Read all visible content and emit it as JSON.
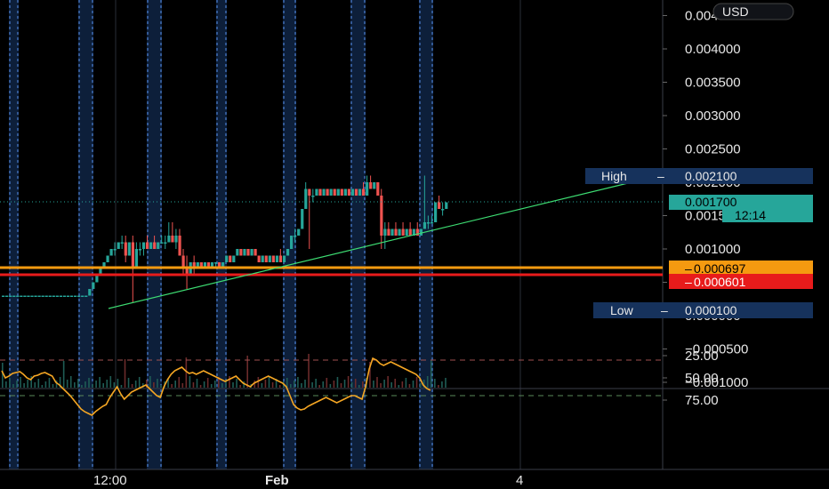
{
  "header": {
    "currency": "USD"
  },
  "colors": {
    "background": "#000000",
    "up": "#26a69a",
    "down": "#ef5350",
    "session_band": "#0d1f3a",
    "session_line": "#4a7fd0",
    "rsi_line": "#f5a623",
    "trendline": "#3ddc72",
    "support_orange": "#f59a10",
    "support_red": "#e81b1b",
    "high_low_tag": "#16325c",
    "current_price_tag": "#26a69a"
  },
  "chart_data": [
    {
      "type": "candlestick",
      "name": "price",
      "y_axis": {
        "ticks": [
          0.0045,
          0.004,
          0.0035,
          0.003,
          0.0025,
          0.002,
          0.0015,
          0.001,
          0.0005,
          0.0,
          -0.0005,
          -0.001
        ],
        "tick_labels": [
          "0.004500",
          "0.004000",
          "0.003500",
          "0.003000",
          "0.002500",
          "0.002000",
          "0.001500",
          "0.001000",
          "0.000500",
          "0.000000",
          "−0.000500",
          "−0.001000"
        ]
      },
      "x_axis": {
        "tick_labels": [
          "12:00",
          "Feb",
          "4"
        ],
        "bold": [
          "Feb"
        ]
      },
      "high": {
        "label": "High",
        "value": "0.002100"
      },
      "low": {
        "label": "Low",
        "value": "0.000100"
      },
      "current_price": {
        "value": "0.001700",
        "countdown": "12:14"
      },
      "levels": [
        {
          "value": "0.000697",
          "color": "#f59a10"
        },
        {
          "value": "0.000601",
          "color": "#e81b1b"
        }
      ],
      "trendline": {
        "from": [
          0.0,
          0.00044
        ],
        "to": [
          1.0,
          0.0021
        ]
      },
      "candles": [
        [
          0.0003,
          0.0003,
          0.0003,
          0.0003
        ],
        [
          0.0003,
          0.0003,
          0.0003,
          0.0003
        ],
        [
          0.0003,
          0.0003,
          0.0003,
          0.0003
        ],
        [
          0.0003,
          0.0003,
          0.0003,
          0.0003
        ],
        [
          0.0003,
          0.0003,
          0.0003,
          0.0003
        ],
        [
          0.0003,
          0.0003,
          0.0003,
          0.0003
        ],
        [
          0.0003,
          0.0003,
          0.0003,
          0.0003
        ],
        [
          0.0003,
          0.0003,
          0.0003,
          0.0003
        ],
        [
          0.0003,
          0.0003,
          0.0003,
          0.0003
        ],
        [
          0.0003,
          0.0003,
          0.0003,
          0.0003
        ],
        [
          0.0003,
          0.0003,
          0.0003,
          0.0003
        ],
        [
          0.0003,
          0.0003,
          0.0003,
          0.0003
        ],
        [
          0.0003,
          0.0003,
          0.0003,
          0.0003
        ],
        [
          0.0003,
          0.0003,
          0.0003,
          0.0003
        ],
        [
          0.0003,
          0.0003,
          0.0003,
          0.0003
        ],
        [
          0.0003,
          0.0003,
          0.0003,
          0.0003
        ],
        [
          0.0003,
          0.0003,
          0.0003,
          0.0003
        ],
        [
          0.0003,
          0.0003,
          0.0003,
          0.0003
        ],
        [
          0.0003,
          0.0003,
          0.0003,
          0.0003
        ],
        [
          0.0003,
          0.0003,
          0.0003,
          0.0003
        ],
        [
          0.0003,
          0.0003,
          0.0003,
          0.0003
        ],
        [
          0.0003,
          0.0003,
          0.0003,
          0.0003
        ],
        [
          0.0003,
          0.0003,
          0.0003,
          0.0003
        ],
        [
          0.0003,
          0.0003,
          0.0003,
          0.0003
        ],
        [
          0.0003,
          0.0004,
          0.0003,
          0.0004
        ],
        [
          0.0004,
          0.0005,
          0.0004,
          0.0005
        ],
        [
          0.0005,
          0.0006,
          0.0005,
          0.0006
        ],
        [
          0.0006,
          0.0007,
          0.0006,
          0.0007
        ],
        [
          0.0007,
          0.0008,
          0.0007,
          0.0008
        ],
        [
          0.0008,
          0.0009,
          0.0008,
          0.0009
        ],
        [
          0.0009,
          0.001,
          0.0009,
          0.001
        ],
        [
          0.001,
          0.0011,
          0.0009,
          0.001
        ],
        [
          0.001,
          0.0011,
          0.001,
          0.0011
        ],
        [
          0.0011,
          0.0012,
          0.001,
          0.0011
        ],
        [
          0.0011,
          0.0012,
          0.0008,
          0.0009
        ],
        [
          0.0009,
          0.0011,
          0.0009,
          0.0011
        ],
        [
          0.0011,
          0.0012,
          0.0002,
          0.0007
        ],
        [
          0.0007,
          0.0011,
          0.0007,
          0.001
        ],
        [
          0.001,
          0.0011,
          0.0009,
          0.001
        ],
        [
          0.001,
          0.0011,
          0.0009,
          0.0011
        ],
        [
          0.0011,
          0.0012,
          0.001,
          0.001
        ],
        [
          0.001,
          0.0011,
          0.001,
          0.0011
        ],
        [
          0.0011,
          0.0012,
          0.001,
          0.001
        ],
        [
          0.001,
          0.0011,
          0.001,
          0.0011
        ],
        [
          0.0011,
          0.0012,
          0.0011,
          0.0011
        ],
        [
          0.0011,
          0.0012,
          0.001,
          0.0011
        ],
        [
          0.0011,
          0.0014,
          0.0011,
          0.0012
        ],
        [
          0.0012,
          0.0014,
          0.0011,
          0.0011
        ],
        [
          0.0011,
          0.0013,
          0.001,
          0.0012
        ],
        [
          0.0012,
          0.0013,
          0.0009,
          0.0009
        ],
        [
          0.0009,
          0.001,
          0.0006,
          0.0007
        ],
        [
          0.0007,
          0.0009,
          0.0004,
          0.0006
        ],
        [
          0.0006,
          0.0008,
          0.0006,
          0.0008
        ],
        [
          0.0008,
          0.0009,
          0.0006,
          0.0007
        ],
        [
          0.0007,
          0.0008,
          0.0007,
          0.0008
        ],
        [
          0.0008,
          0.0008,
          0.0007,
          0.0007
        ],
        [
          0.0007,
          0.0008,
          0.0007,
          0.0008
        ],
        [
          0.0008,
          0.0008,
          0.0007,
          0.0007
        ],
        [
          0.0007,
          0.0008,
          0.0007,
          0.0008
        ],
        [
          0.0008,
          0.0008,
          0.0007,
          0.0008
        ],
        [
          0.0008,
          0.0008,
          0.0007,
          0.0007
        ],
        [
          0.0007,
          0.0008,
          0.0007,
          0.0008
        ],
        [
          0.0008,
          0.0009,
          0.0008,
          0.0009
        ],
        [
          0.0009,
          0.0009,
          0.0008,
          0.0008
        ],
        [
          0.0008,
          0.0009,
          0.0008,
          0.0009
        ],
        [
          0.0009,
          0.001,
          0.0009,
          0.001
        ],
        [
          0.001,
          0.001,
          0.0009,
          0.0009
        ],
        [
          0.0009,
          0.001,
          0.0009,
          0.001
        ],
        [
          0.001,
          0.001,
          0.0009,
          0.0009
        ],
        [
          0.0009,
          0.001,
          0.0009,
          0.001
        ],
        [
          0.001,
          0.001,
          0.0009,
          0.0009
        ],
        [
          0.0009,
          0.0009,
          0.0008,
          0.0008
        ],
        [
          0.0008,
          0.0009,
          0.0008,
          0.0009
        ],
        [
          0.0009,
          0.0009,
          0.0008,
          0.0008
        ],
        [
          0.0008,
          0.0009,
          0.0008,
          0.0009
        ],
        [
          0.0009,
          0.0009,
          0.0008,
          0.0008
        ],
        [
          0.0008,
          0.0009,
          0.0008,
          0.0009
        ],
        [
          0.0009,
          0.001,
          0.0008,
          0.0008
        ],
        [
          0.0008,
          0.0009,
          0.0008,
          0.0009
        ],
        [
          0.0009,
          0.001,
          0.0009,
          0.001
        ],
        [
          0.001,
          0.0012,
          0.001,
          0.0012
        ],
        [
          0.0012,
          0.0013,
          0.0011,
          0.0012
        ],
        [
          0.0012,
          0.0013,
          0.0012,
          0.0013
        ],
        [
          0.0013,
          0.0016,
          0.0013,
          0.0016
        ],
        [
          0.0016,
          0.002,
          0.0016,
          0.0019
        ],
        [
          0.0019,
          0.0019,
          0.001,
          0.0018
        ],
        [
          0.0018,
          0.0019,
          0.0017,
          0.0018
        ],
        [
          0.0018,
          0.0019,
          0.0018,
          0.0019
        ],
        [
          0.0019,
          0.0019,
          0.0018,
          0.0018
        ],
        [
          0.0018,
          0.0019,
          0.0018,
          0.0019
        ],
        [
          0.0019,
          0.0019,
          0.0018,
          0.0018
        ],
        [
          0.0018,
          0.0019,
          0.0018,
          0.0019
        ],
        [
          0.0019,
          0.0019,
          0.0018,
          0.0018
        ],
        [
          0.0018,
          0.0019,
          0.0018,
          0.0019
        ],
        [
          0.0019,
          0.0019,
          0.0018,
          0.0018
        ],
        [
          0.0018,
          0.0019,
          0.0018,
          0.0019
        ],
        [
          0.0019,
          0.0019,
          0.0018,
          0.0018
        ],
        [
          0.0018,
          0.0019,
          0.0018,
          0.0019
        ],
        [
          0.0019,
          0.0019,
          0.0018,
          0.0018
        ],
        [
          0.0018,
          0.0019,
          0.0018,
          0.0019
        ],
        [
          0.0019,
          0.002,
          0.0018,
          0.0018
        ],
        [
          0.0018,
          0.0021,
          0.0018,
          0.002
        ],
        [
          0.002,
          0.0021,
          0.0019,
          0.0019
        ],
        [
          0.0019,
          0.002,
          0.0019,
          0.002
        ],
        [
          0.002,
          0.002,
          0.0018,
          0.0018
        ],
        [
          0.0018,
          0.0019,
          0.001,
          0.0012
        ],
        [
          0.0012,
          0.0014,
          0.001,
          0.0013
        ],
        [
          0.0013,
          0.0014,
          0.0012,
          0.0012
        ],
        [
          0.0012,
          0.0013,
          0.0012,
          0.0013
        ],
        [
          0.0013,
          0.0014,
          0.0012,
          0.0012
        ],
        [
          0.0012,
          0.0013,
          0.0012,
          0.0013
        ],
        [
          0.0013,
          0.0014,
          0.0012,
          0.0012
        ],
        [
          0.0012,
          0.0013,
          0.0012,
          0.0013
        ],
        [
          0.0013,
          0.0014,
          0.0012,
          0.0012
        ],
        [
          0.0012,
          0.0013,
          0.0012,
          0.0013
        ],
        [
          0.0013,
          0.0014,
          0.0012,
          0.0012
        ],
        [
          0.0012,
          0.0013,
          0.0012,
          0.0013
        ],
        [
          0.0013,
          0.0021,
          0.0013,
          0.0014
        ],
        [
          0.0014,
          0.0015,
          0.0013,
          0.0014
        ],
        [
          0.0014,
          0.0015,
          0.0014,
          0.0014
        ],
        [
          0.0014,
          0.0017,
          0.0014,
          0.0017
        ],
        [
          0.0017,
          0.0018,
          0.0016,
          0.0016
        ],
        [
          0.0016,
          0.0017,
          0.0015,
          0.0016
        ],
        [
          0.0016,
          0.0017,
          0.0016,
          0.0017
        ]
      ]
    },
    {
      "type": "line",
      "name": "RSI",
      "y_axis": {
        "ticks": [
          75,
          50,
          25
        ],
        "tick_labels": [
          "75.00",
          "50.00",
          "25.00"
        ]
      },
      "band": [
        30,
        70
      ],
      "values": [
        42,
        50,
        48,
        45,
        44,
        43,
        46,
        50,
        52,
        48,
        47,
        45,
        44,
        46,
        48,
        55,
        58,
        62,
        66,
        70,
        75,
        80,
        85,
        88,
        90,
        92,
        88,
        85,
        82,
        80,
        72,
        66,
        60,
        68,
        74,
        70,
        66,
        64,
        62,
        60,
        58,
        62,
        66,
        70,
        72,
        60,
        52,
        46,
        42,
        40,
        38,
        42,
        45,
        44,
        46,
        44,
        42,
        44,
        46,
        48,
        50,
        52,
        54,
        52,
        50,
        48,
        52,
        56,
        58,
        60,
        56,
        54,
        52,
        50,
        48,
        50,
        52,
        54,
        56,
        60,
        70,
        80,
        84,
        86,
        85,
        82,
        80,
        78,
        76,
        74,
        72,
        74,
        76,
        78,
        76,
        74,
        72,
        70,
        70,
        72,
        74,
        60,
        40,
        28,
        30,
        34,
        36,
        34,
        32,
        34,
        36,
        38,
        40,
        42,
        44,
        46,
        50,
        58,
        62,
        64
      ]
    }
  ]
}
